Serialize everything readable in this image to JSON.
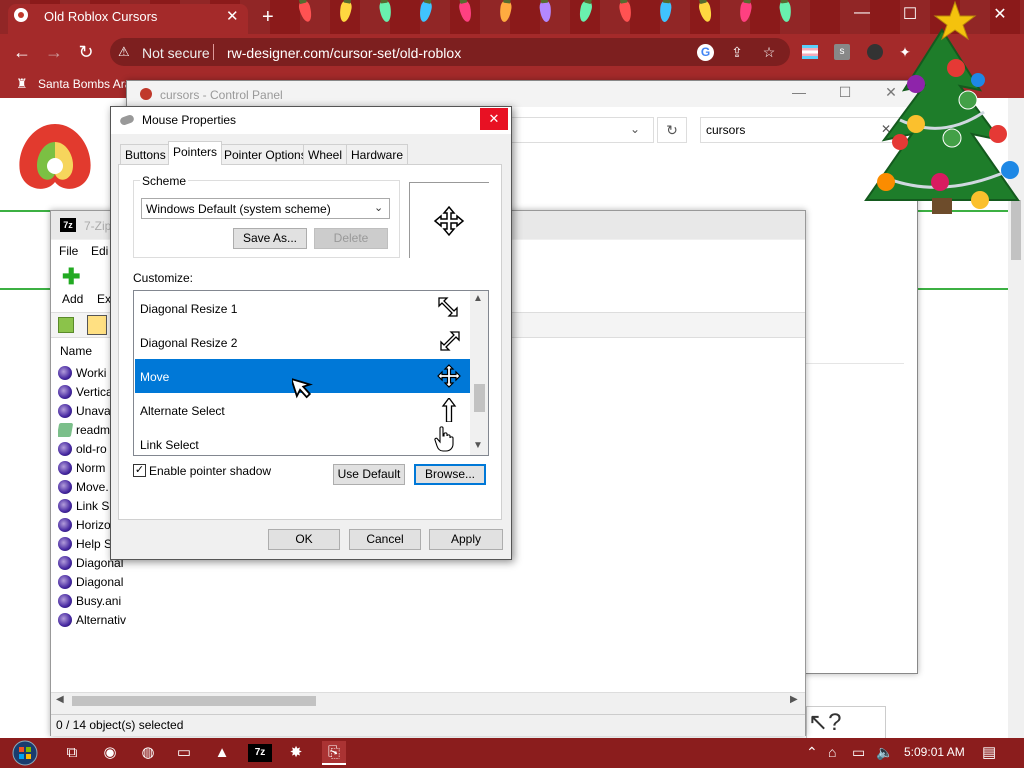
{
  "browser": {
    "tab_title": "Old Roblox Cursors",
    "new_tab": "+",
    "close_tab": "✕",
    "security": "Not secure",
    "url": "rw-designer.com/cursor-set/old-roblox",
    "bookmark": "Santa Bombs Ara",
    "window_controls": {
      "minimize": "—",
      "maximize": "☐",
      "close": "✕"
    },
    "colors": {
      "theme": "#a42a2a"
    }
  },
  "control_panel": {
    "title": "cursors - Control Panel",
    "search_value": "cursors"
  },
  "zip": {
    "title": "7-Zip",
    "menu": [
      "File",
      "Edi"
    ],
    "toolbar": {
      "add": "Add",
      "extract": "Ex"
    },
    "column_name": "Name",
    "files": [
      {
        "name": "Worki",
        "type": "cursor"
      },
      {
        "name": "Vertica",
        "type": "cursor"
      },
      {
        "name": "Unava",
        "type": "cursor"
      },
      {
        "name": "readm",
        "type": "text"
      },
      {
        "name": "old-ro",
        "type": "cursor"
      },
      {
        "name": "Norm",
        "type": "cursor"
      },
      {
        "name": "Move.",
        "type": "cursor"
      },
      {
        "name": "Link S",
        "type": "cursor"
      },
      {
        "name": "Horizo",
        "type": "cursor"
      },
      {
        "name": "Help S",
        "type": "cursor"
      },
      {
        "name": "Diagonal",
        "type": "cursor"
      },
      {
        "name": "Diagonal",
        "type": "cursor"
      },
      {
        "name": "Busy.ani",
        "type": "cursor"
      },
      {
        "name": "Alternativ",
        "type": "cursor"
      }
    ],
    "status": "0 / 14 object(s) selected"
  },
  "mouse_properties": {
    "title": "Mouse Properties",
    "close": "✕",
    "tabs": [
      "Buttons",
      "Pointers",
      "Pointer Options",
      "Wheel",
      "Hardware"
    ],
    "active_tab": "Pointers",
    "scheme_label": "Scheme",
    "scheme_value": "Windows Default (system scheme)",
    "save_as": "Save As...",
    "delete": "Delete",
    "customize_label": "Customize:",
    "cursors": [
      {
        "label": "Diagonal Resize 1",
        "icon": "diagonal-resize-nwse-icon"
      },
      {
        "label": "Diagonal Resize 2",
        "icon": "diagonal-resize-nesw-icon"
      },
      {
        "label": "Move",
        "icon": "move-icon",
        "selected": true
      },
      {
        "label": "Alternate Select",
        "icon": "up-arrow-icon"
      },
      {
        "label": "Link Select",
        "icon": "hand-pointer-icon"
      }
    ],
    "enable_shadow_label": "Enable pointer shadow",
    "enable_shadow_checked": true,
    "check_mark": "✓",
    "use_default": "Use Default",
    "browse": "Browse...",
    "ok": "OK",
    "cancel": "Cancel",
    "apply": "Apply",
    "colors": {
      "selection": "#0078d7"
    }
  },
  "taskbar": {
    "clock": "5:09:01 AM",
    "apps": [
      "task-view-icon",
      "chrome-icon",
      "firefox-icon",
      "file-explorer-icon",
      "vlc-icon",
      "7zip-icon",
      "roblox-icon",
      "attachment-icon"
    ],
    "zip_label": "7z"
  }
}
